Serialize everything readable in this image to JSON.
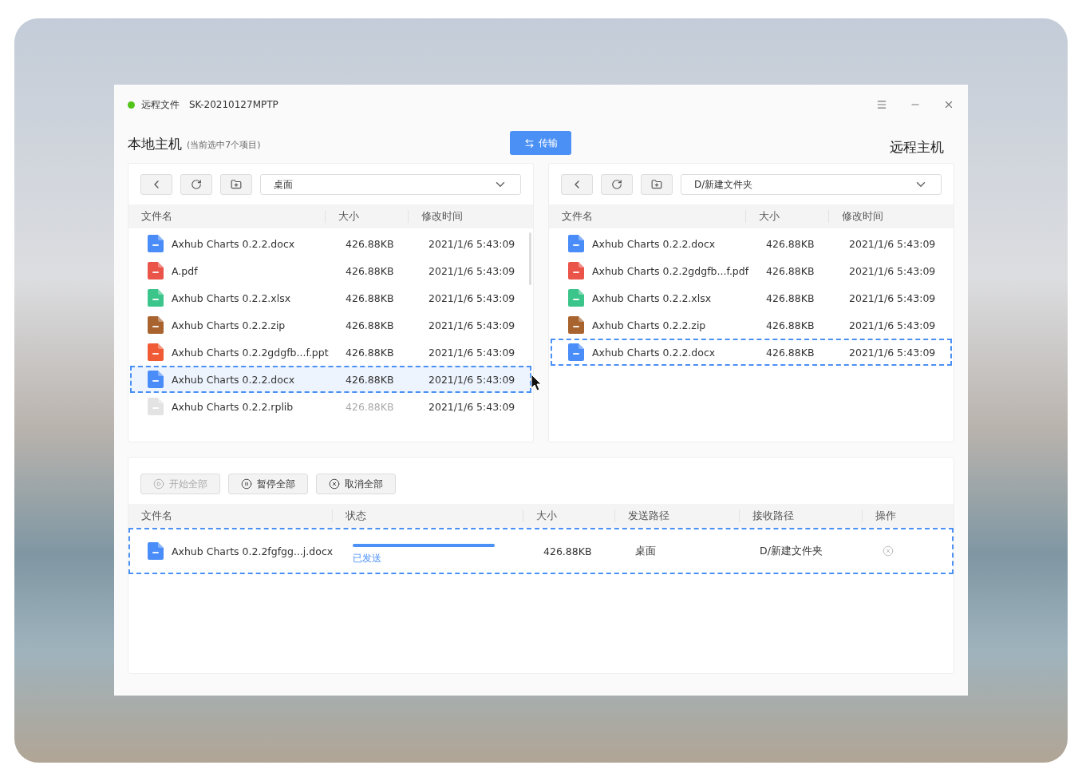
{
  "window": {
    "online": true,
    "title": "远程文件",
    "device": "SK-20210127MPTP"
  },
  "local": {
    "title": "本地主机",
    "subtitle": "(当前选中7个项目)",
    "path": "桌面",
    "columns": [
      "文件名",
      "大小",
      "修改时间"
    ],
    "rows": [
      {
        "kind": "docx",
        "name": "Axhub Charts 0.2.2.docx",
        "size": "426.88KB",
        "time": "2021/1/6 5:43:09",
        "selected": false,
        "outlined": false,
        "disabled": false
      },
      {
        "kind": "pdf",
        "name": "A.pdf",
        "size": "426.88KB",
        "time": "2021/1/6 5:43:09",
        "selected": false,
        "outlined": false,
        "disabled": false
      },
      {
        "kind": "xlsx",
        "name": "Axhub Charts 0.2.2.xlsx",
        "size": "426.88KB",
        "time": "2021/1/6 5:43:09",
        "selected": false,
        "outlined": false,
        "disabled": false
      },
      {
        "kind": "zip",
        "name": "Axhub Charts 0.2.2.zip",
        "size": "426.88KB",
        "time": "2021/1/6 5:43:09",
        "selected": false,
        "outlined": false,
        "disabled": false
      },
      {
        "kind": "ppt",
        "name": "Axhub Charts 0.2.2gdgfb...f.ppt",
        "size": "426.88KB",
        "time": "2021/1/6 5:43:09",
        "selected": false,
        "outlined": false,
        "disabled": false
      },
      {
        "kind": "docx",
        "name": "Axhub Charts 0.2.2.docx",
        "size": "426.88KB",
        "time": "2021/1/6 5:43:09",
        "selected": true,
        "outlined": true,
        "disabled": false
      },
      {
        "kind": "unknown",
        "name": "Axhub Charts 0.2.2.rplib",
        "size": "426.88KB",
        "time": "2021/1/6 5:43:09",
        "selected": false,
        "outlined": false,
        "disabled": true
      }
    ]
  },
  "transfer_button": "传输",
  "remote": {
    "title": "远程主机",
    "path": "D/新建文件夹",
    "columns": [
      "文件名",
      "大小",
      "修改时间"
    ],
    "rows": [
      {
        "kind": "docx",
        "name": "Axhub Charts 0.2.2.docx",
        "size": "426.88KB",
        "time": "2021/1/6 5:43:09",
        "selected": false,
        "outlined": false,
        "disabled": false
      },
      {
        "kind": "pdf",
        "name": "Axhub Charts 0.2.2gdgfb...f.pdf",
        "size": "426.88KB",
        "time": "2021/1/6 5:43:09",
        "selected": false,
        "outlined": false,
        "disabled": false
      },
      {
        "kind": "xlsx",
        "name": "Axhub Charts 0.2.2.xlsx",
        "size": "426.88KB",
        "time": "2021/1/6 5:43:09",
        "selected": false,
        "outlined": false,
        "disabled": false
      },
      {
        "kind": "zip",
        "name": "Axhub Charts 0.2.2.zip",
        "size": "426.88KB",
        "time": "2021/1/6 5:43:09",
        "selected": false,
        "outlined": false,
        "disabled": false
      },
      {
        "kind": "docx",
        "name": "Axhub Charts 0.2.2.docx",
        "size": "426.88KB",
        "time": "2021/1/6 5:43:09",
        "selected": false,
        "outlined": true,
        "disabled": false
      }
    ]
  },
  "queue": {
    "actions": [
      {
        "kind": "start",
        "label": "开始全部",
        "disabled": true
      },
      {
        "kind": "pause",
        "label": "暂停全部",
        "disabled": false
      },
      {
        "kind": "cancel",
        "label": "取消全部",
        "disabled": false
      }
    ],
    "columns": [
      "文件名",
      "状态",
      "大小",
      "发送路径",
      "接收路径",
      "操作"
    ],
    "rows": [
      {
        "kind": "docx",
        "name": "Axhub Charts 0.2.2fgfgg...j.docx",
        "level": 1,
        "status": "已发送",
        "size": "426.88KB",
        "from": "桌面",
        "to": "D/新建文件夹",
        "outlined": true
      }
    ]
  }
}
